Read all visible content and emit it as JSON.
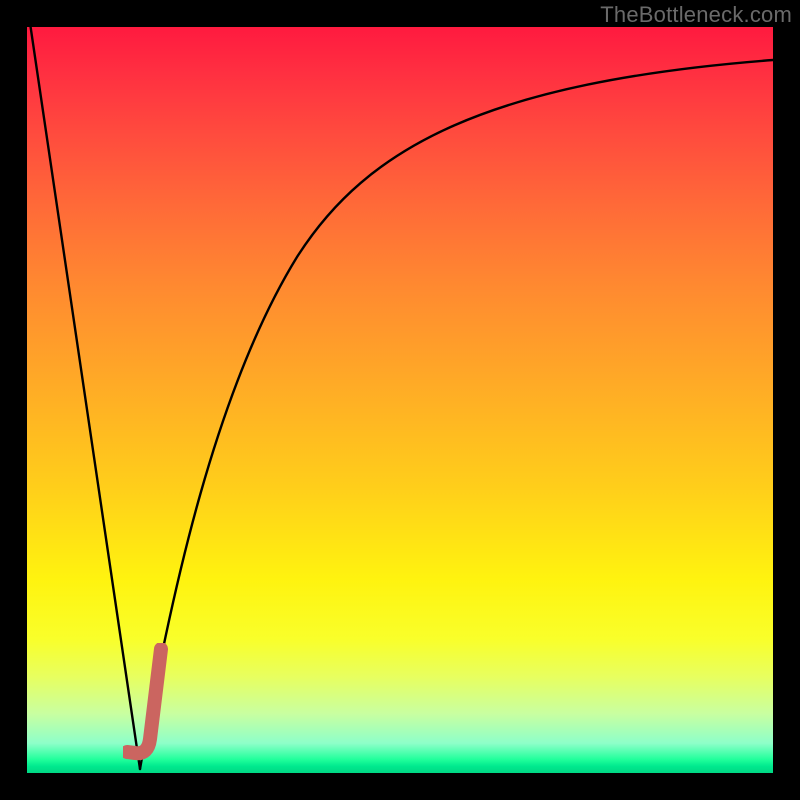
{
  "watermark": "TheBottleneck.com",
  "colors": {
    "frame": "#000000",
    "curve": "#000000",
    "marker": "#cb6560",
    "watermark_text": "#6a6a6a"
  },
  "chart_data": {
    "type": "line",
    "title": "",
    "xlabel": "",
    "ylabel": "",
    "xlim": [
      0,
      100
    ],
    "ylim": [
      0,
      100
    ],
    "grid": false,
    "legend": false,
    "background": "vertical-heatmap-gradient (red high → green low)",
    "series": [
      {
        "name": "left-branch",
        "x": [
          0,
          2,
          4,
          6,
          8,
          10,
          12,
          14,
          15
        ],
        "values": [
          100,
          87,
          73,
          60,
          47,
          33,
          20,
          7,
          0
        ]
      },
      {
        "name": "right-branch",
        "x": [
          15,
          17,
          19,
          22,
          26,
          30,
          35,
          40,
          48,
          58,
          70,
          85,
          100
        ],
        "values": [
          0,
          12,
          24,
          38,
          52,
          62,
          70,
          76,
          82,
          87,
          91,
          93.5,
          95
        ]
      }
    ],
    "marker": {
      "name": "j-hook",
      "approx_x_range": [
        13,
        18
      ],
      "approx_y_range": [
        0,
        14
      ],
      "color": "#cb6560",
      "description": "thick rounded J-shaped stroke near the curve minimum"
    }
  }
}
